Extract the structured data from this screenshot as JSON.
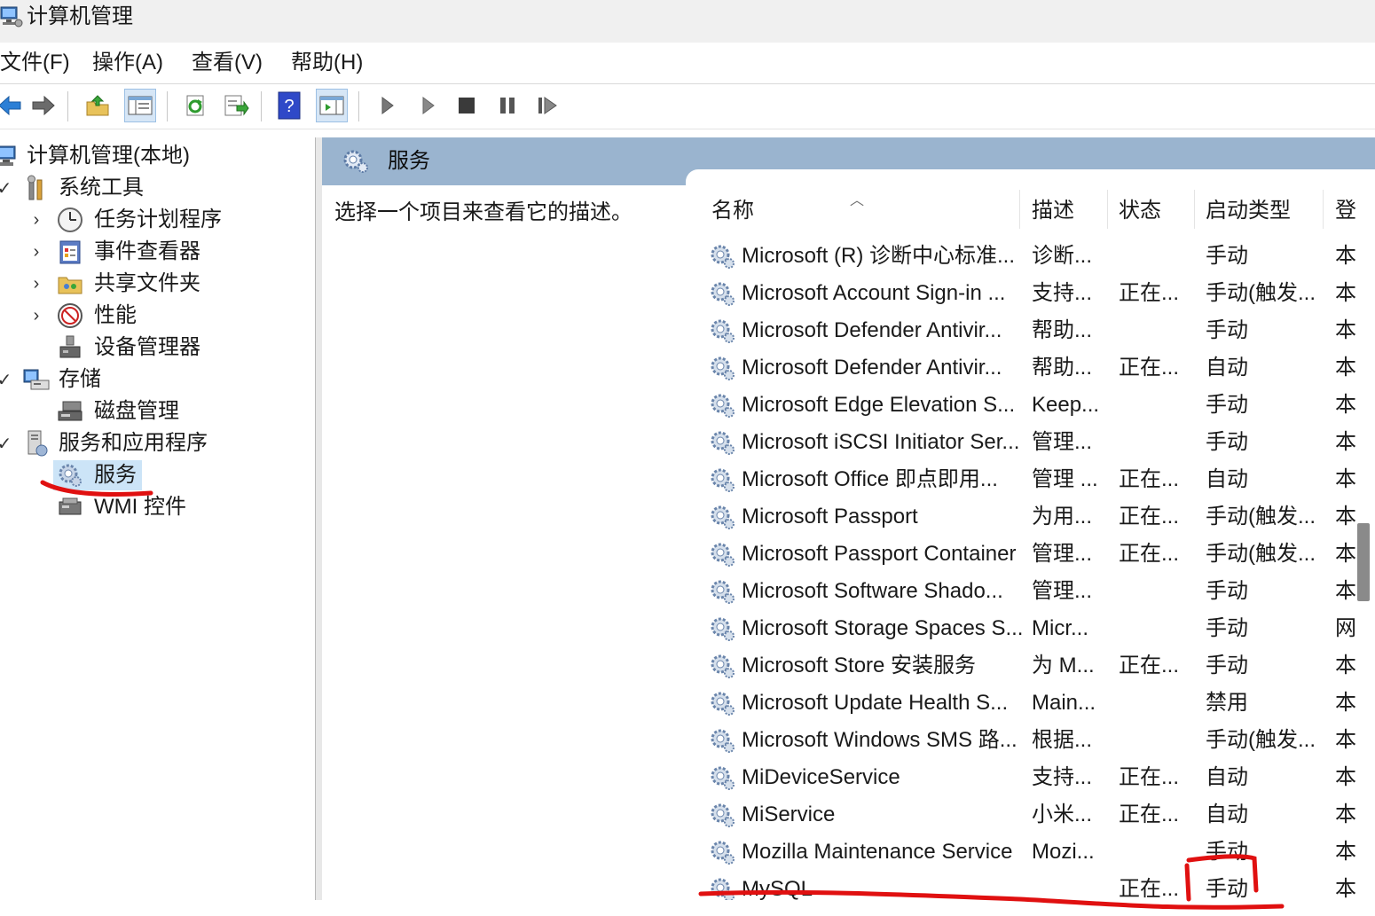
{
  "window": {
    "title": "计算机管理"
  },
  "menu": [
    "文件(F)",
    "操作(A)",
    "查看(V)",
    "帮助(H)"
  ],
  "toolbar": {
    "buttons": [
      "back-icon",
      "forward-icon",
      "up-folder-icon",
      "show-hide-tree-icon",
      "refresh-icon",
      "export-list-icon",
      "help-icon",
      "show-action-pane-icon",
      "start-service-icon",
      "start-service-alt-icon",
      "stop-service-icon",
      "pause-service-icon",
      "restart-service-icon"
    ]
  },
  "tree": {
    "items": [
      {
        "label": "计算机管理(本地)",
        "icon": "computer-management-icon"
      },
      {
        "label": "系统工具",
        "icon": "system-tools-icon"
      },
      {
        "label": "任务计划程序",
        "icon": "task-scheduler-icon"
      },
      {
        "label": "事件查看器",
        "icon": "event-viewer-icon"
      },
      {
        "label": "共享文件夹",
        "icon": "shared-folders-icon"
      },
      {
        "label": "性能",
        "icon": "performance-icon"
      },
      {
        "label": "设备管理器",
        "icon": "device-manager-icon"
      },
      {
        "label": "存储",
        "icon": "storage-icon"
      },
      {
        "label": "磁盘管理",
        "icon": "disk-management-icon"
      },
      {
        "label": "服务和应用程序",
        "icon": "services-applications-icon"
      },
      {
        "label": "服务",
        "icon": "services-gear-icon"
      },
      {
        "label": "WMI 控件",
        "icon": "wmi-control-icon"
      }
    ]
  },
  "content": {
    "header_title": "服务",
    "description": "选择一个项目来查看它的描述。"
  },
  "table": {
    "columns": [
      "名称",
      "描述",
      "状态",
      "启动类型",
      "登"
    ],
    "rows": [
      {
        "name": "Microsoft (R) 诊断中心标准...",
        "desc": "诊断...",
        "status": "",
        "startup": "手动",
        "logon": "本"
      },
      {
        "name": "Microsoft Account Sign-in ...",
        "desc": "支持...",
        "status": "正在...",
        "startup": "手动(触发...",
        "logon": "本"
      },
      {
        "name": "Microsoft Defender Antivir...",
        "desc": "帮助...",
        "status": "",
        "startup": "手动",
        "logon": "本"
      },
      {
        "name": "Microsoft Defender Antivir...",
        "desc": "帮助...",
        "status": "正在...",
        "startup": "自动",
        "logon": "本"
      },
      {
        "name": "Microsoft Edge Elevation S...",
        "desc": "Keep...",
        "status": "",
        "startup": "手动",
        "logon": "本"
      },
      {
        "name": "Microsoft iSCSI Initiator Ser...",
        "desc": "管理...",
        "status": "",
        "startup": "手动",
        "logon": "本"
      },
      {
        "name": "Microsoft Office 即点即用...",
        "desc": "管理 ...",
        "status": "正在...",
        "startup": "自动",
        "logon": "本"
      },
      {
        "name": "Microsoft Passport",
        "desc": "为用...",
        "status": "正在...",
        "startup": "手动(触发...",
        "logon": "本"
      },
      {
        "name": "Microsoft Passport Container",
        "desc": "管理...",
        "status": "正在...",
        "startup": "手动(触发...",
        "logon": "本"
      },
      {
        "name": "Microsoft Software Shado...",
        "desc": "管理...",
        "status": "",
        "startup": "手动",
        "logon": "本"
      },
      {
        "name": "Microsoft Storage Spaces S...",
        "desc": "Micr...",
        "status": "",
        "startup": "手动",
        "logon": "网"
      },
      {
        "name": "Microsoft Store 安装服务",
        "desc": "为 M...",
        "status": "正在...",
        "startup": "手动",
        "logon": "本"
      },
      {
        "name": "Microsoft Update Health S...",
        "desc": "Main...",
        "status": "",
        "startup": "禁用",
        "logon": "本"
      },
      {
        "name": "Microsoft Windows SMS 路...",
        "desc": "根据...",
        "status": "",
        "startup": "手动(触发...",
        "logon": "本"
      },
      {
        "name": "MiDeviceService",
        "desc": "支持...",
        "status": "正在...",
        "startup": "自动",
        "logon": "本"
      },
      {
        "name": "MiService",
        "desc": "小米...",
        "status": "正在...",
        "startup": "自动",
        "logon": "本"
      },
      {
        "name": "Mozilla Maintenance Service",
        "desc": "Mozi...",
        "status": "",
        "startup": "手动",
        "logon": "本"
      },
      {
        "name": "MySQL",
        "desc": "",
        "status": "正在...",
        "startup": "手动",
        "logon": "本"
      }
    ]
  },
  "colors": {
    "header_bg": "#9ab4cf",
    "selection_bg": "#cce4f7",
    "annotation": "#e01010"
  }
}
